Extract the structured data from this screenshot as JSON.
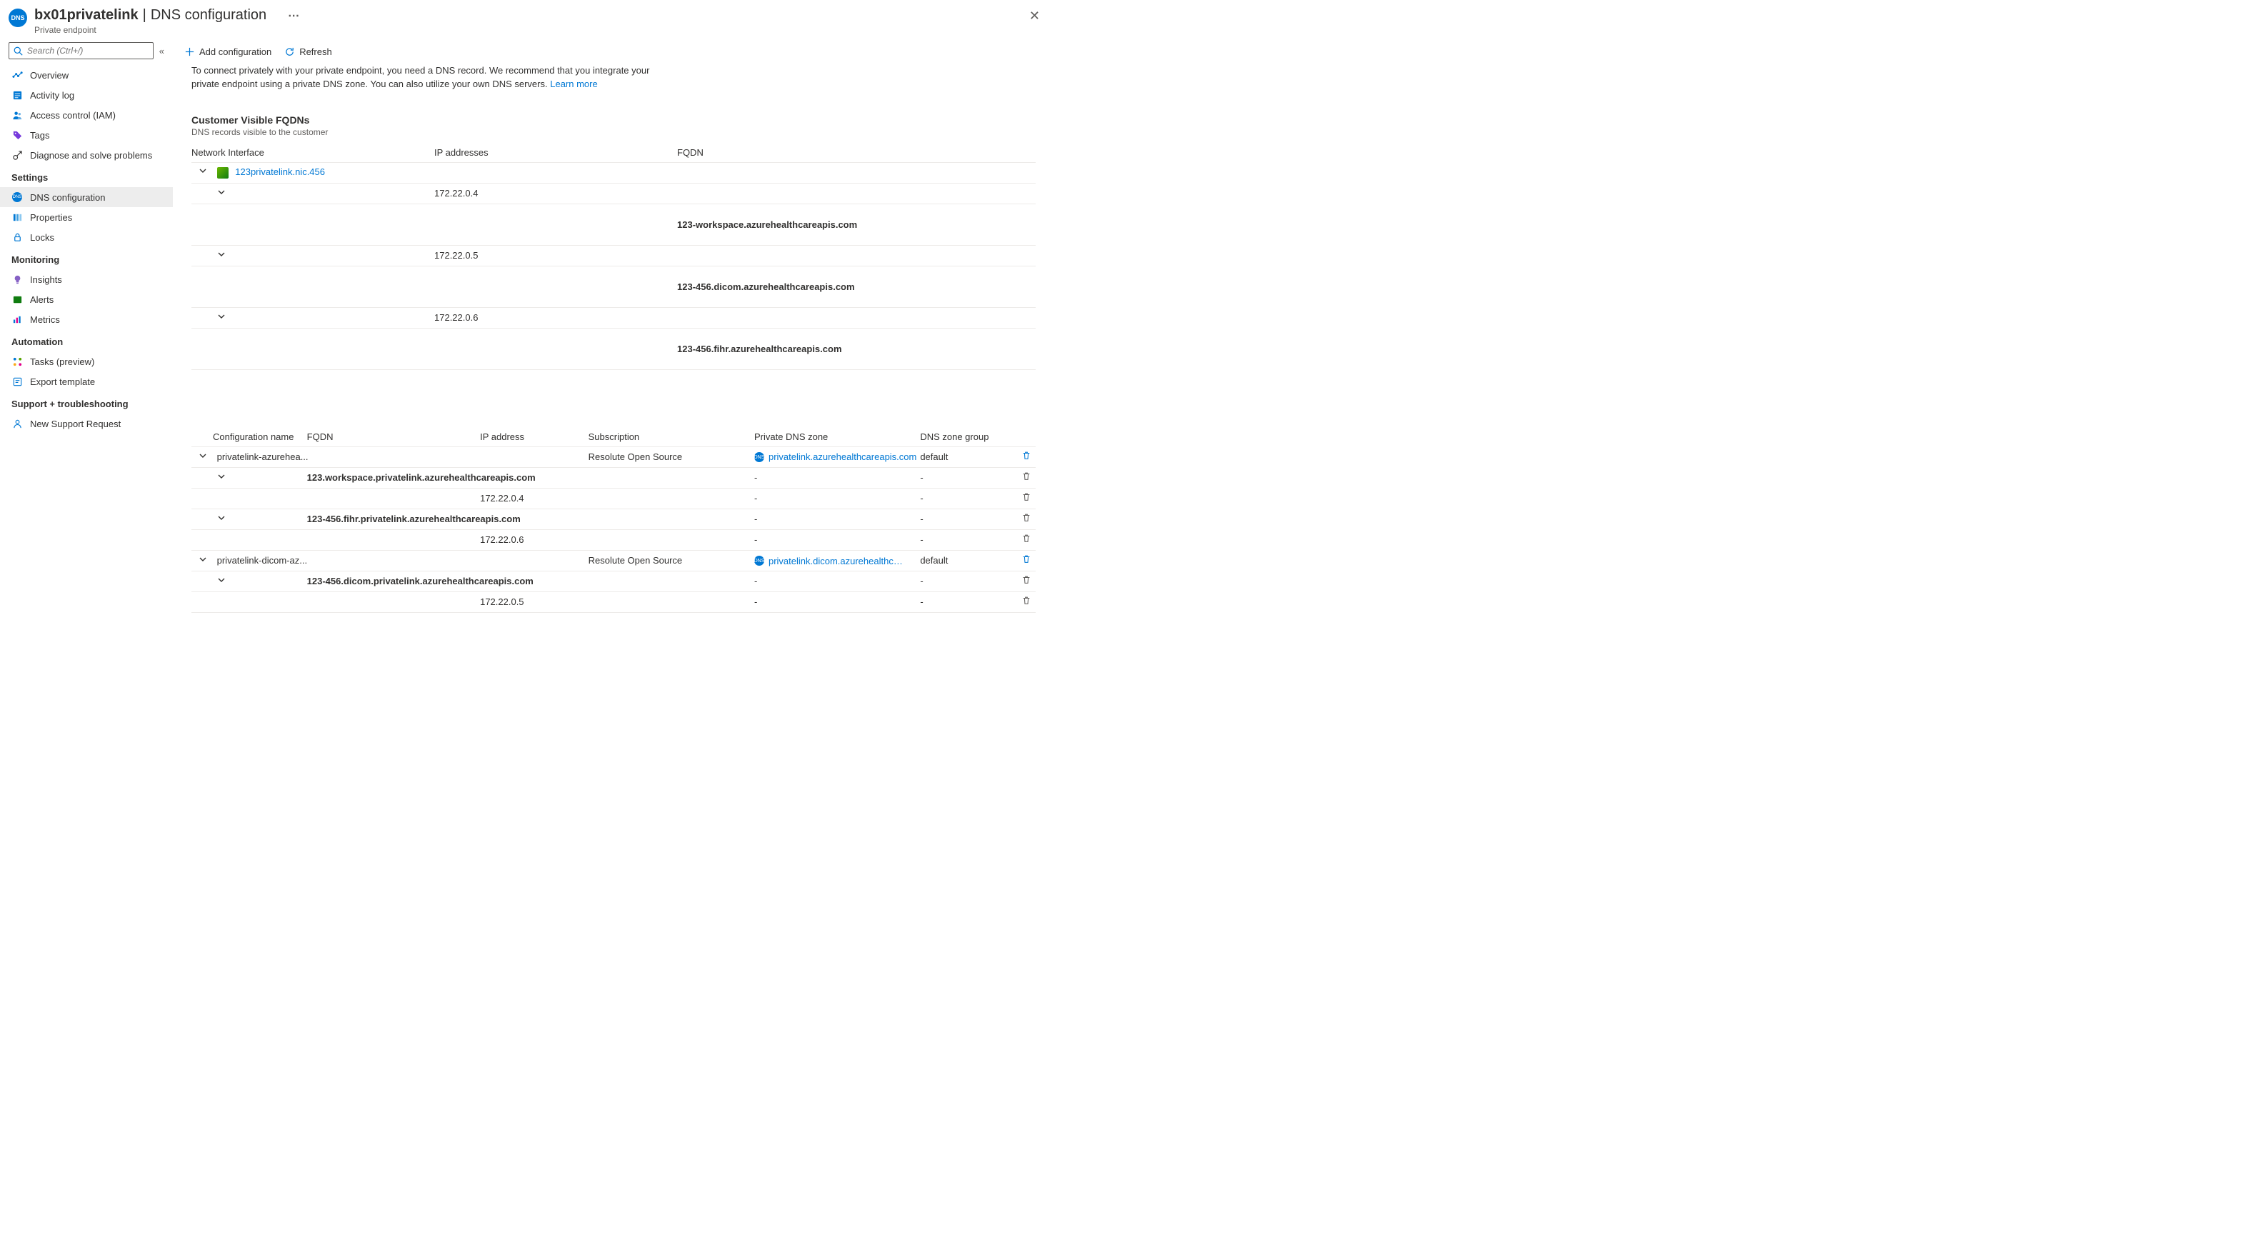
{
  "header": {
    "resource_name": "bx01privatelink",
    "page_title": "DNS configuration",
    "resource_type": "Private endpoint"
  },
  "search": {
    "placeholder": "Search (Ctrl+/)"
  },
  "nav": {
    "top": [
      {
        "label": "Overview"
      },
      {
        "label": "Activity log"
      },
      {
        "label": "Access control (IAM)"
      },
      {
        "label": "Tags"
      },
      {
        "label": "Diagnose and solve problems"
      }
    ],
    "settings_title": "Settings",
    "settings": [
      {
        "label": "DNS configuration",
        "active": true
      },
      {
        "label": "Properties"
      },
      {
        "label": "Locks"
      }
    ],
    "monitoring_title": "Monitoring",
    "monitoring": [
      {
        "label": "Insights"
      },
      {
        "label": "Alerts"
      },
      {
        "label": "Metrics"
      }
    ],
    "automation_title": "Automation",
    "automation": [
      {
        "label": "Tasks (preview)"
      },
      {
        "label": "Export template"
      }
    ],
    "support_title": "Support + troubleshooting",
    "support": [
      {
        "label": "New Support Request"
      }
    ]
  },
  "toolbar": {
    "add_configuration": "Add configuration",
    "refresh": "Refresh"
  },
  "intro": {
    "text": "To connect privately with your private endpoint, you need a DNS record. We recommend that you integrate your private endpoint using a private DNS zone. You can also utilize your own DNS servers.",
    "learn_more": "Learn more"
  },
  "fqdn_section": {
    "title": "Customer Visible FQDNs",
    "subtitle": "DNS records visible to the customer",
    "cols": {
      "nic": "Network Interface",
      "ip": "IP addresses",
      "fqdn": "FQDN"
    },
    "nic_link": "123privatelink.nic.456",
    "rows": [
      {
        "ip": "172.22.0.4",
        "fqdn": "123-workspace.azurehealthcareapis.com"
      },
      {
        "ip": "172.22.0.5",
        "fqdn": "123-456.dicom.azurehealthcareapis.com"
      },
      {
        "ip": "172.22.0.6",
        "fqdn": "123-456.fihr.azurehealthcareapis.com"
      }
    ]
  },
  "cfg_section": {
    "cols": {
      "name": "Configuration name",
      "fqdn": "FQDN",
      "ip": "IP address",
      "sub": "Subscription",
      "zone": "Private DNS zone",
      "group": "DNS zone group"
    },
    "groups": [
      {
        "name": "privatelink-azurehea...",
        "subscription": "Resolute Open Source",
        "zone": "privatelink.azurehealthcareapis.com",
        "zone_group": "default",
        "records": [
          {
            "fqdn": "123.workspace.privatelink.azurehealthcareapis.com",
            "ip": "172.22.0.4"
          },
          {
            "fqdn": "123-456.fihr.privatelink.azurehealthcareapis.com",
            "ip": "172.22.0.6"
          }
        ]
      },
      {
        "name": "privatelink-dicom-az...",
        "subscription": "Resolute Open Source",
        "zone": "privatelink.dicom.azurehealthcarea…",
        "zone_group": "default",
        "records": [
          {
            "fqdn": "123-456.dicom.privatelink.azurehealthcareapis.com",
            "ip": "172.22.0.5"
          }
        ]
      }
    ]
  }
}
